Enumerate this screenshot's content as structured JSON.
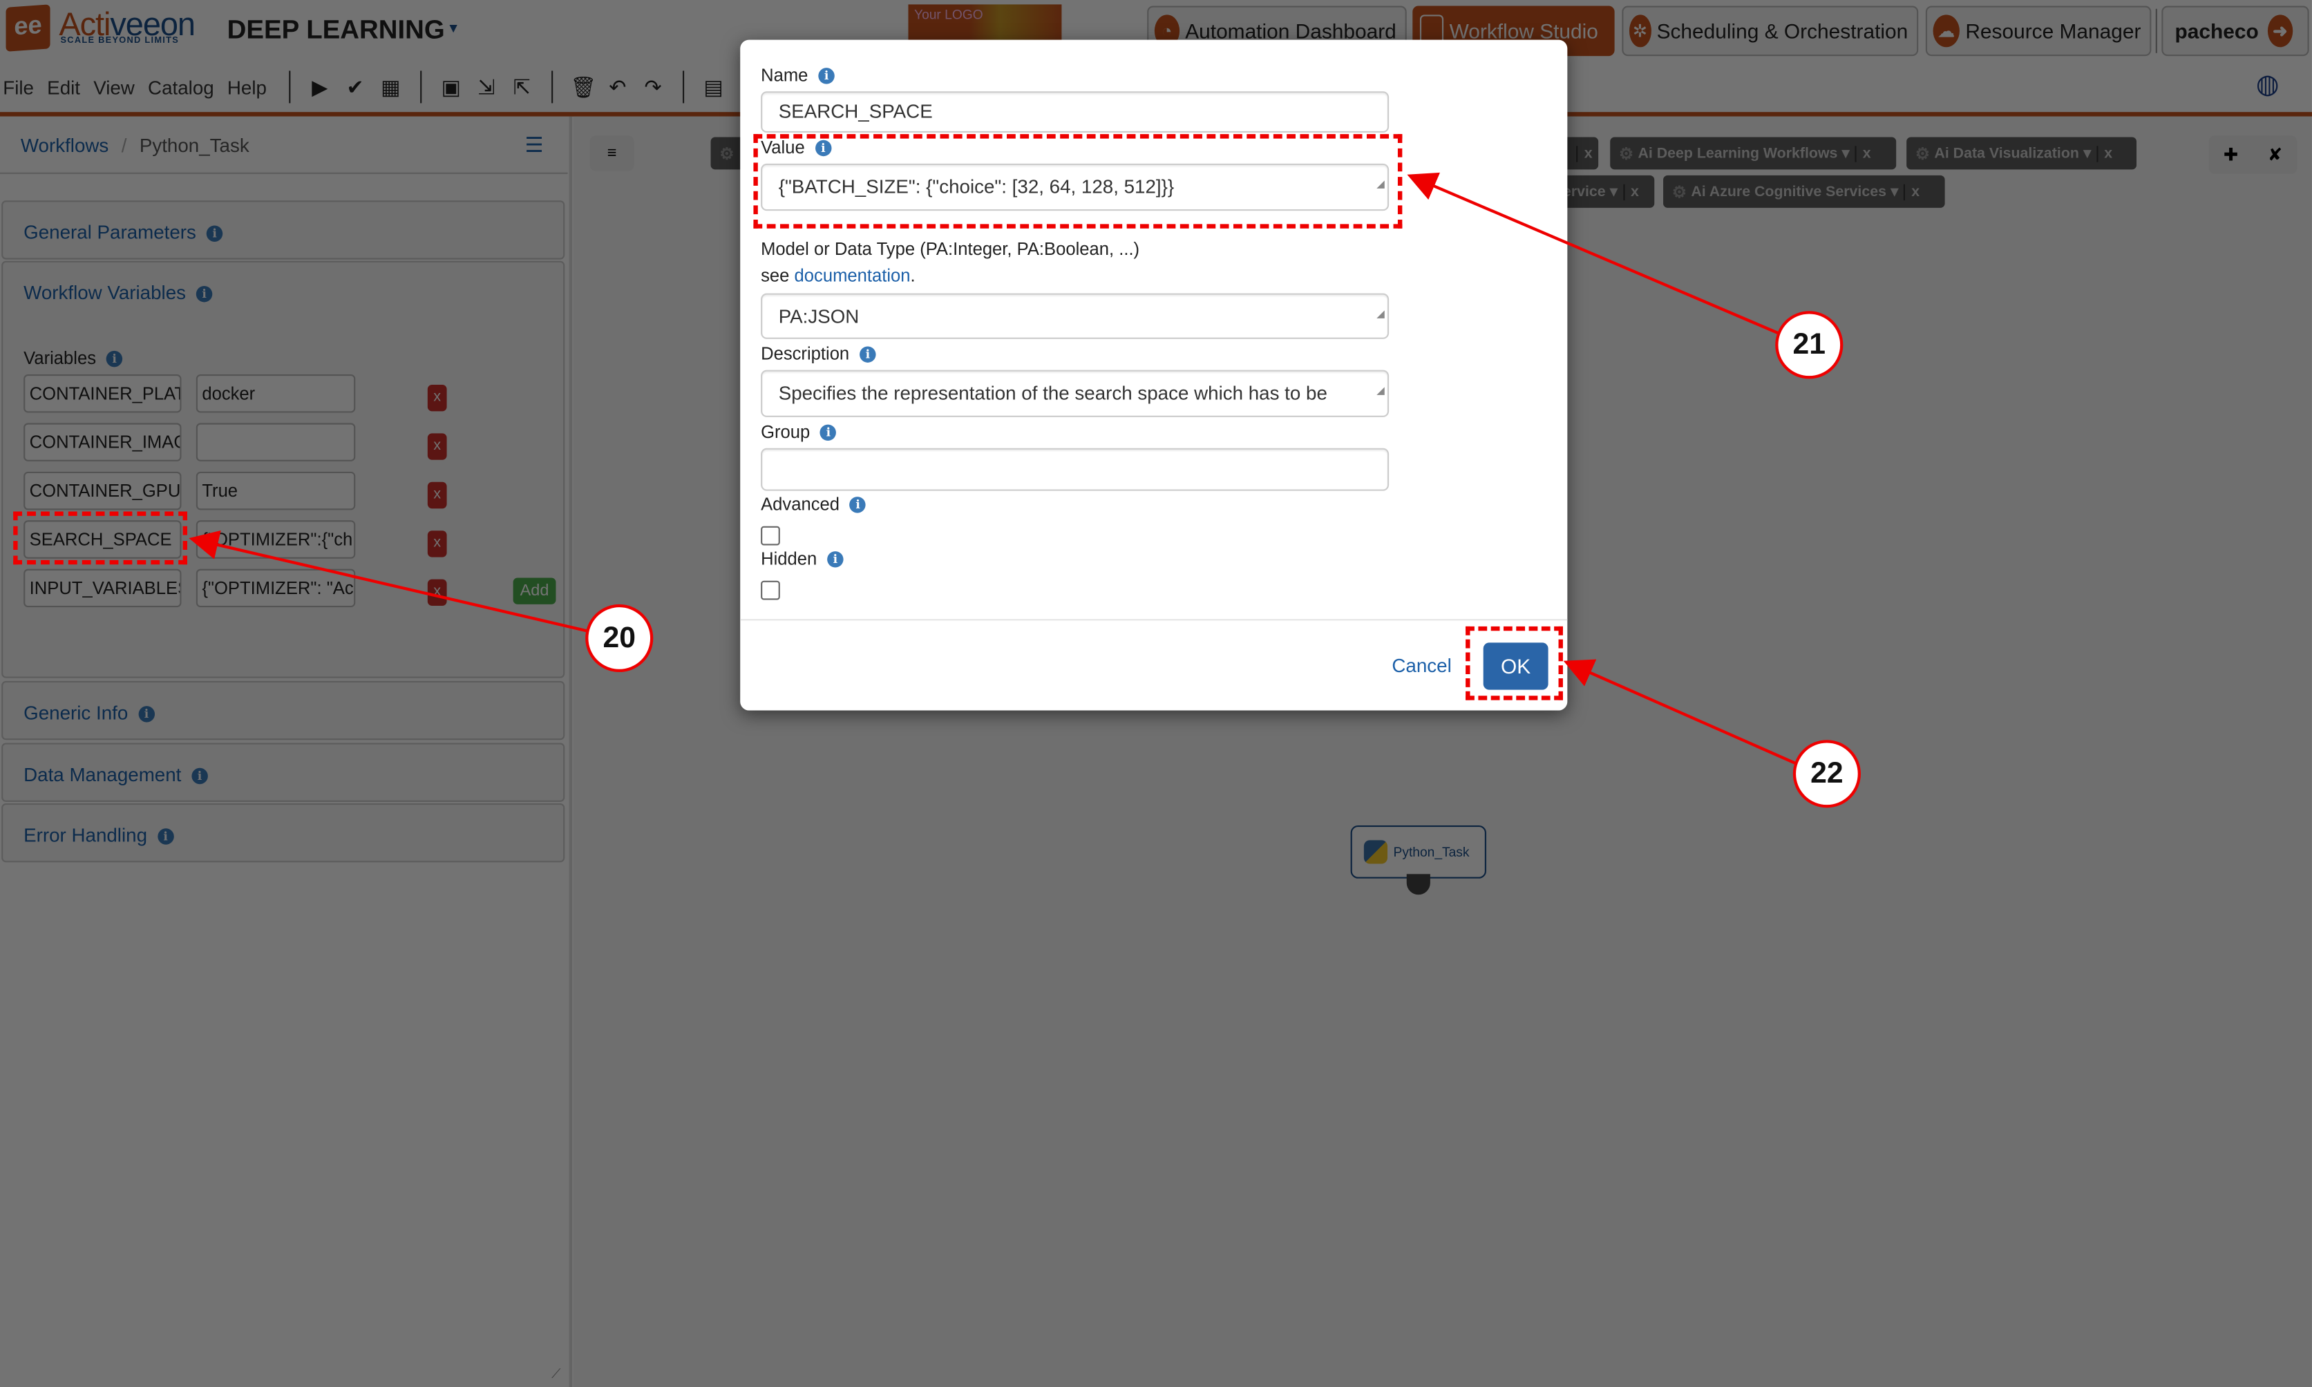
{
  "header": {
    "brand": {
      "logo_glyph": "ee",
      "name_a": "Acti",
      "name_b": "veeon",
      "tagline": "SCALE BEYOND LIMITS"
    },
    "app_title": "DEEP LEARNING",
    "your_logo": "Your LOGO",
    "portals": [
      {
        "label": "Automation Dashboard",
        "icon": "gauge-icon",
        "glyph": "◔",
        "active": false
      },
      {
        "label": "Workflow Studio",
        "icon": "workflow-icon",
        "glyph": "",
        "active": true
      },
      {
        "label": "Scheduling & Orchestration",
        "icon": "gears-icon",
        "glyph": "✲",
        "active": false
      },
      {
        "label": "Resource Manager",
        "icon": "cloud-icon",
        "glyph": "☁",
        "active": false
      }
    ],
    "user": {
      "name": "pacheco",
      "icon": "logout-icon",
      "glyph": "➜"
    },
    "colors": {
      "accent": "#c6531e",
      "link": "#1b5fa8",
      "primary": "#2a65a8"
    }
  },
  "menubar": {
    "menus": [
      "File",
      "Edit",
      "View",
      "Catalog",
      "Help"
    ],
    "tools": [
      {
        "name": "execute-icon",
        "glyph": "▶"
      },
      {
        "name": "validate-icon",
        "glyph": "✔"
      },
      {
        "name": "schedule-icon",
        "glyph": "▦"
      },
      {
        "name": "save-icon",
        "glyph": "▣"
      },
      {
        "name": "import-icon",
        "glyph": "⇲"
      },
      {
        "name": "export-icon",
        "glyph": "⇱"
      },
      {
        "name": "delete-icon",
        "glyph": "🗑"
      },
      {
        "name": "undo-icon",
        "glyph": "↶"
      },
      {
        "name": "redo-icon",
        "glyph": "↷"
      },
      {
        "name": "catalog-folder-icon",
        "glyph": "▤"
      }
    ]
  },
  "left_panel": {
    "breadcrumb": {
      "root": "Workflows",
      "sep": "/",
      "current": "Python_Task"
    },
    "sections": {
      "general": "General Parameters",
      "workflow_variables": "Workflow Variables",
      "generic_info": "Generic Info",
      "data_management": "Data Management",
      "error_handling": "Error Handling"
    },
    "variables_label": "Variables",
    "variables": [
      {
        "name": "CONTAINER_PLAT",
        "value": "docker"
      },
      {
        "name": "CONTAINER_IMAG",
        "value": ""
      },
      {
        "name": "CONTAINER_GPU_",
        "value": "True"
      },
      {
        "name": "SEARCH_SPACE",
        "value": "{\"OPTIMIZER\":{\"ch"
      },
      {
        "name": "INPUT_VARIABLES",
        "value": "{\"OPTIMIZER\": \"Ac"
      }
    ],
    "remove_label": "x",
    "add_label": "Add"
  },
  "canvas": {
    "buckets": [
      {
        "label": "Ai Deep Learning Workflows"
      },
      {
        "label": "Ai Data Visualization"
      },
      {
        "label": "ervice"
      },
      {
        "label": "Ai Azure Cognitive Services"
      }
    ],
    "task": {
      "label": "Python_Task"
    }
  },
  "modal": {
    "name_label": "Name",
    "name_value": "SEARCH_SPACE",
    "value_label": "Value",
    "value_value": "{\"BATCH_SIZE\": {\"choice\": [32, 64, 128, 512]}}",
    "model_label": "Model or Data Type (PA:Integer, PA:Boolean, ...)",
    "see_text": "see",
    "doc_link": "documentation",
    "period": ".",
    "model_value": "PA:JSON",
    "description_label": "Description",
    "description_value": "Specifies the representation of the search space which has to be defined using dictionaries or by entering the path of a json file",
    "group_label": "Group",
    "group_value": "",
    "advanced_label": "Advanced",
    "advanced_checked": false,
    "hidden_label": "Hidden",
    "hidden_checked": false,
    "cancel_label": "Cancel",
    "ok_label": "OK"
  },
  "annotations": [
    {
      "number": "20",
      "target": "SEARCH_SPACE variable name"
    },
    {
      "number": "21",
      "target": "Value field"
    },
    {
      "number": "22",
      "target": "OK button"
    }
  ]
}
